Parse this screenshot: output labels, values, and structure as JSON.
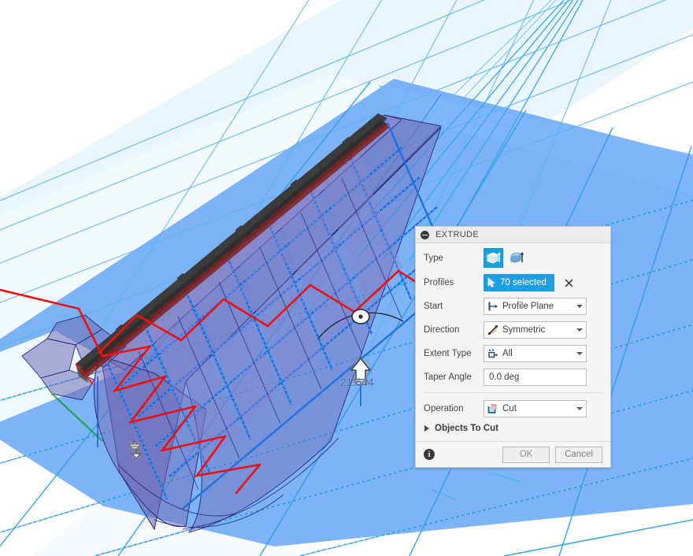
{
  "viewport": {
    "name": "3d-modeling-viewport",
    "background_color": "#ffffff",
    "ground_plane_color": "#63a4f5",
    "ground_plane_light_color": "#eaf5fe",
    "grid_line_color": "#29a3ee",
    "body_fill_color": "#6f6bb5",
    "body_edge_color": "#2b2a80",
    "sketch_line_color": "#ee1111",
    "dark_strip_color": "#3c3c3c",
    "manipulator": {
      "value": "21.644",
      "value_color": "#3f6fa8",
      "arrow_handle": "extrude-distance-arrow",
      "rotate_handle": "rotation-handle-dot"
    }
  },
  "dialog": {
    "title": "EXTRUDE",
    "collapse_icon": "collapse-circle-icon",
    "rows": {
      "type": {
        "label": "Type",
        "options": [
          {
            "name": "profile-extrude-icon",
            "selected": true
          },
          {
            "name": "taper-extrude-icon",
            "selected": false
          }
        ]
      },
      "profiles": {
        "label": "Profiles",
        "chip_text": "70 selected",
        "chip_icon": "cursor-arrow-icon",
        "clear_icon": "×",
        "chip_color": "#1aa0e0"
      },
      "start": {
        "label": "Start",
        "value": "Profile Plane",
        "icon": "profile-plane-icon",
        "caret": "chevron-down-icon"
      },
      "direction": {
        "label": "Direction",
        "value": "Symmetric",
        "icon": "symmetric-arrows-icon",
        "caret": "chevron-down-icon"
      },
      "extent_type": {
        "label": "Extent Type",
        "value": "All",
        "icon": "extent-all-icon",
        "caret": "chevron-down-icon"
      },
      "taper_angle": {
        "label": "Taper Angle",
        "value": "0.0 deg"
      },
      "operation": {
        "label": "Operation",
        "value": "Cut",
        "icon": "cut-operation-icon",
        "caret": "chevron-down-icon"
      }
    },
    "section": {
      "label": "Objects To Cut",
      "expander_icon": "triangle-right-icon",
      "expanded": false
    },
    "footer": {
      "info_icon": "info-icon",
      "info_glyph": "i",
      "ok_label": "OK",
      "cancel_label": "Cancel"
    }
  }
}
